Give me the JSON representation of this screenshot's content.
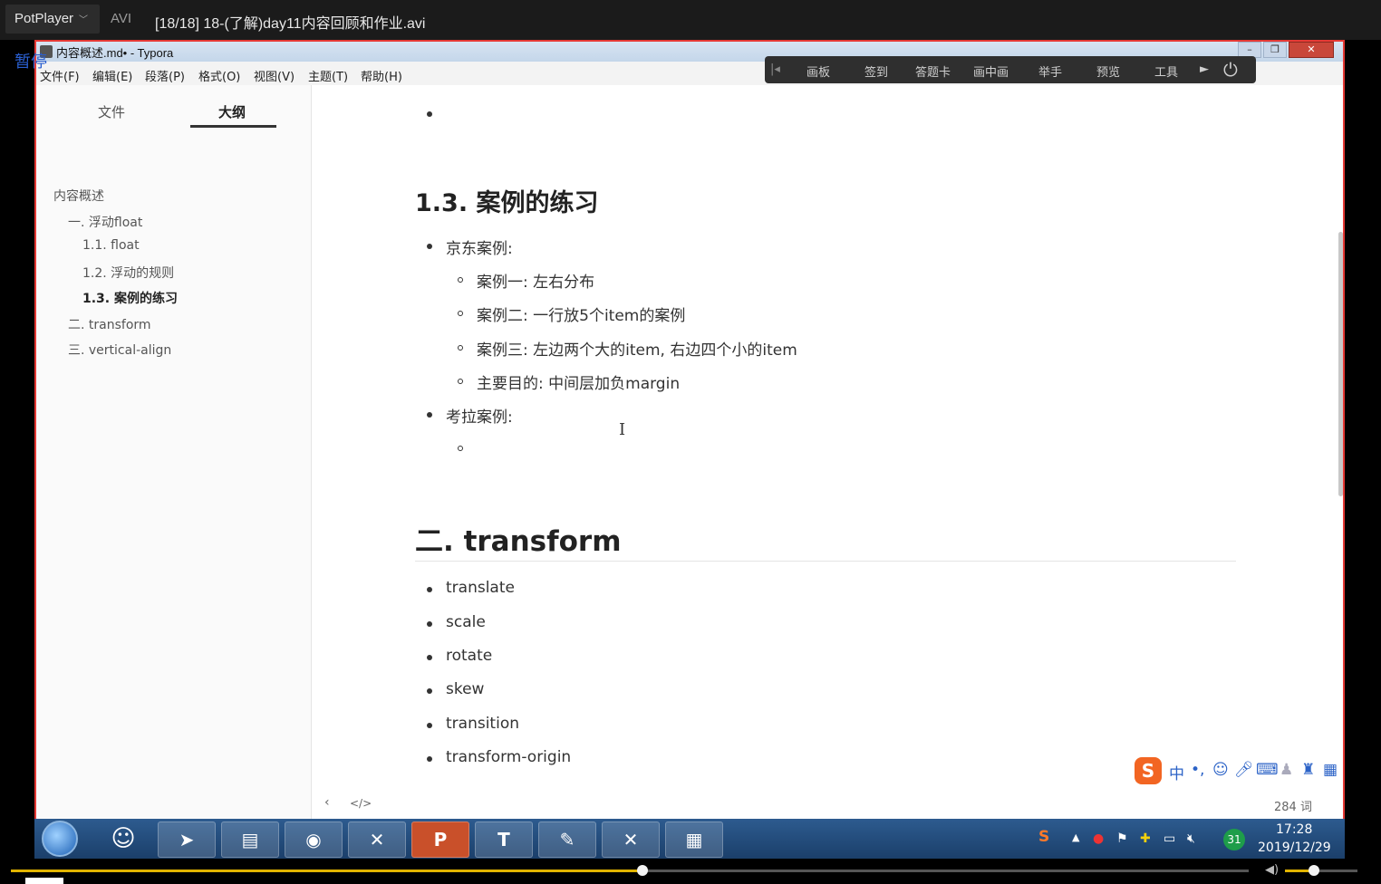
{
  "player": {
    "app_name": "PotPlayer",
    "format": "AVI",
    "file_title": "[18/18] 18-(了解)day11内容回顾和作业.avi",
    "paused_label": "暂停",
    "progress": 0.51,
    "volume": 0.4
  },
  "window": {
    "title": "内容概述.md• - Typora",
    "menu": [
      "文件(F)",
      "编辑(E)",
      "段落(P)",
      "格式(O)",
      "视图(V)",
      "主题(T)",
      "帮助(H)"
    ]
  },
  "float_toolbar": {
    "items": [
      "画板",
      "签到",
      "答题卡",
      "画中画",
      "举手",
      "预览",
      "工具"
    ]
  },
  "sidebar": {
    "tabs": [
      "文件",
      "大纲"
    ],
    "active_tab": "大纲",
    "outline": [
      {
        "label": "内容概述",
        "level": 0,
        "active": false
      },
      {
        "label": "一. 浮动float",
        "level": 1,
        "active": false
      },
      {
        "label": "1.1. float",
        "level": 2,
        "active": false
      },
      {
        "label": "1.2. 浮动的规则",
        "level": 2,
        "active": false
      },
      {
        "label": "1.3. 案例的练习",
        "level": 2,
        "active": true
      },
      {
        "label": "二. transform",
        "level": 1,
        "active": false
      },
      {
        "label": "三. vertical-align",
        "level": 1,
        "active": false
      }
    ]
  },
  "content": {
    "heading_13": "1.3. 案例的练习",
    "jd_case": "京东案例:",
    "jd_items": [
      "案例一: 左右分布",
      "案例二: 一行放5个item的案例",
      "案例三: 左边两个大的item, 右边四个小的item",
      "主要目的: 中间层加负margin"
    ],
    "kaola_case": "考拉案例:",
    "heading_2": "二. transform",
    "transform_items": [
      "translate",
      "scale",
      "rotate",
      "skew",
      "transition",
      "transform-origin"
    ],
    "word_count": "284 词"
  },
  "taskbar": {
    "time": "17:28",
    "date": "2019/12/29",
    "badge": "31"
  },
  "colors": {
    "window_border": "#e53935",
    "accent_blue": "#2c63c7",
    "seek_fill": "#e2b400"
  }
}
